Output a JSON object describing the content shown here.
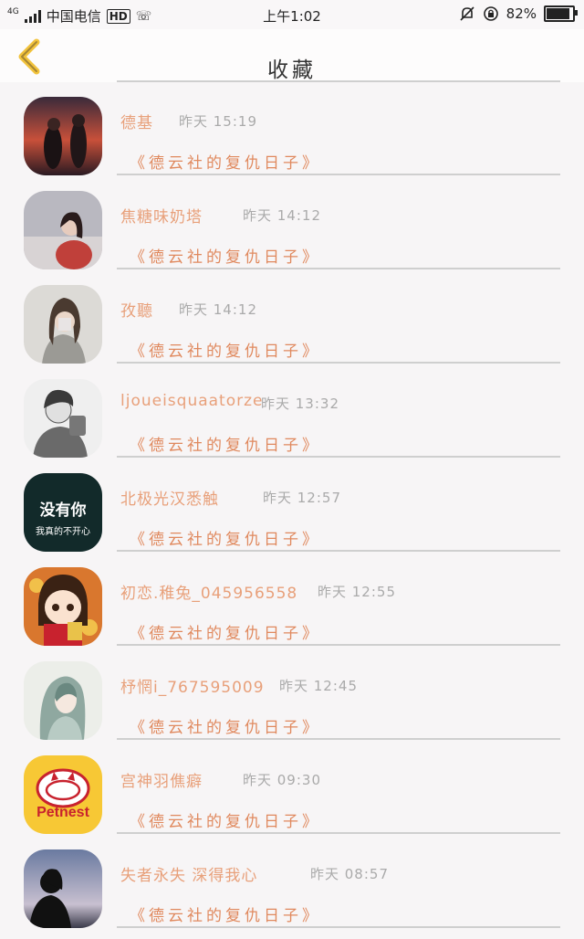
{
  "status_bar": {
    "network": "4G",
    "carrier": "中国电信",
    "hd": "HD",
    "time": "上午1:02",
    "battery": "82%",
    "battery_level": 0.82
  },
  "header": {
    "title": "收藏"
  },
  "items": [
    {
      "name": "德基",
      "time": "昨天 15:19",
      "quote": "《德云社的复仇日子》",
      "avatar": "couple-photo"
    },
    {
      "name": "焦糖味奶塔",
      "time": "昨天 14:12",
      "quote": "《德云社的复仇日子》",
      "avatar": "girl-photo"
    },
    {
      "name": "孜聽",
      "time": "昨天 14:12",
      "quote": "《德云社的复仇日子》",
      "avatar": "girl-selfie"
    },
    {
      "name": "ljoueisquaatorze",
      "time": "昨天 13:32",
      "quote": "《德云社的复仇日子》",
      "avatar": "sketch-boy"
    },
    {
      "name": "北极光汉悉触",
      "time": "昨天 12:57",
      "quote": "《德云社的复仇日子》",
      "avatar": "text-avatar",
      "avatar_text": "没有你",
      "avatar_subtext": "我真的不开心"
    },
    {
      "name": "初恋.稚兔_045956558",
      "time": "昨天 12:55",
      "quote": "《德云社的复仇日子》",
      "avatar": "cartoon-girl"
    },
    {
      "name": "杼惘i_767595009",
      "time": "昨天 12:45",
      "quote": "《德云社的复仇日子》",
      "avatar": "illustrated-girl"
    },
    {
      "name": "宫神羽僬癖",
      "time": "昨天 09:30",
      "quote": "《德云社的复仇日子》",
      "avatar": "petnest-logo",
      "avatar_text": "Petnest"
    },
    {
      "name": "失者永失 深得我心",
      "time": "昨天 08:57",
      "quote": "《德云社的复仇日子》",
      "avatar": "silhouette-photo"
    }
  ]
}
